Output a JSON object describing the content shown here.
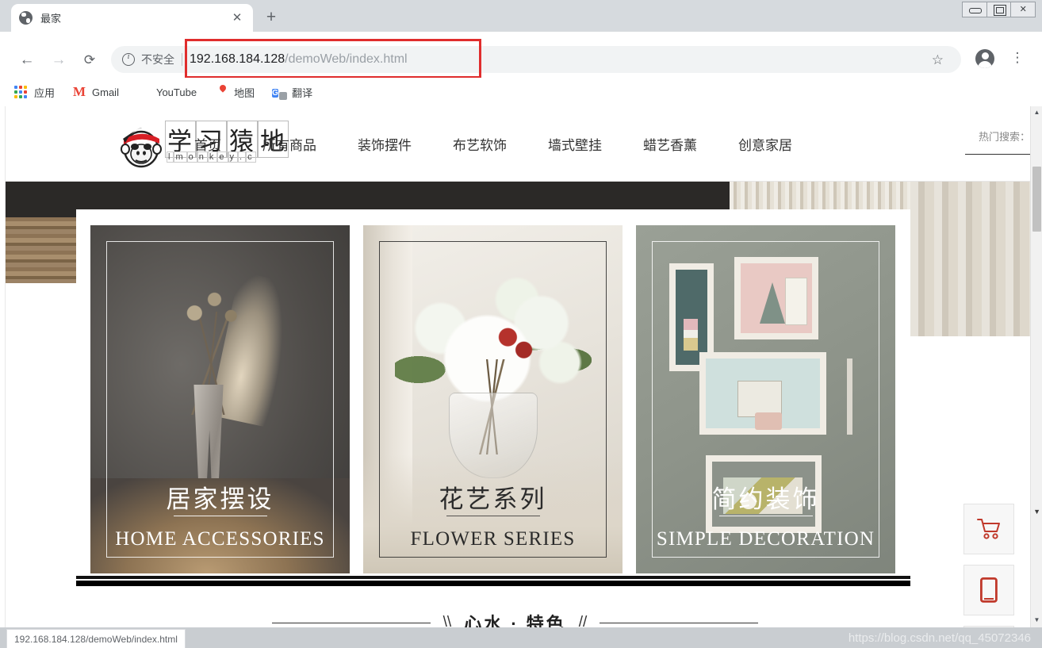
{
  "browser": {
    "tab": {
      "title": "最家",
      "favicon": "globe-icon",
      "close": "✕"
    },
    "new_tab_label": "+",
    "window_controls": {
      "minimize": "minimize-icon",
      "maximize": "maximize-icon",
      "close": "✕"
    },
    "nav": {
      "back": "←",
      "forward": "→",
      "reload": "⟳"
    },
    "omnibox": {
      "security_label": "不安全",
      "url_host": "192.168.184.128",
      "url_path": "/demoWeb/index.html",
      "star": "☆",
      "highlight_color": "#e02d2d"
    },
    "profile": "avatar-icon",
    "menu": "⋮",
    "bookmarks": [
      {
        "label": "应用",
        "icon": "apps-grid-icon"
      },
      {
        "label": "Gmail",
        "icon": "gmail-icon"
      },
      {
        "label": "YouTube",
        "icon": "youtube-icon"
      },
      {
        "label": "地图",
        "icon": "maps-icon"
      },
      {
        "label": "翻译",
        "icon": "translate-icon"
      }
    ],
    "status_text": "192.168.184.128/demoWeb/index.html",
    "watermark": "https://blog.csdn.net/qq_45072346"
  },
  "site": {
    "logo": {
      "cn": [
        "学",
        "习",
        "猿",
        "地"
      ],
      "en": [
        "l",
        "m",
        "o",
        "n",
        "k",
        "e",
        "y",
        ".",
        "c"
      ]
    },
    "nav_items": [
      {
        "label": "首页"
      },
      {
        "label": "所有商品"
      },
      {
        "label": "装饰摆件"
      },
      {
        "label": "布艺软饰"
      },
      {
        "label": "墙式壁挂"
      },
      {
        "label": "蜡艺香薰"
      },
      {
        "label": "创意家居"
      }
    ],
    "hot_search_label": "热门搜索：",
    "cards": [
      {
        "cn": "居家摆设",
        "en": "HOME ACCESSORIES",
        "theme": "light"
      },
      {
        "cn": "花艺系列",
        "en": "FLOWER SERIES",
        "theme": "dark"
      },
      {
        "cn": "简约装饰",
        "en": "SIMPLE DECORATION",
        "theme": "light"
      }
    ],
    "section_heading": {
      "left_slash": "\\\\",
      "text": "心水 · 特色",
      "right_slash": "//"
    },
    "float_buttons": [
      {
        "icon": "shopping-cart-icon",
        "color": "#c0392b"
      },
      {
        "icon": "mobile-phone-icon",
        "color": "#c0392b"
      }
    ]
  },
  "scrollbar": {
    "up": "▲",
    "down": "▼"
  }
}
